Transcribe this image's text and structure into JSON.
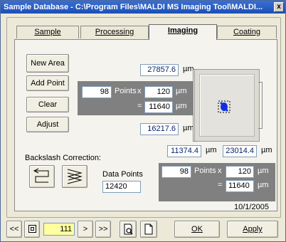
{
  "window": {
    "title": "Sample Database - C:\\Program Files\\MALDI MS Imaging Tool\\MALDI...",
    "close_glyph": "x"
  },
  "tabs": [
    {
      "label": "Sample",
      "active": false
    },
    {
      "label": "Processing",
      "active": false
    },
    {
      "label": "Imaging",
      "active": true
    },
    {
      "label": "Coating",
      "active": false
    }
  ],
  "buttons": {
    "new_area": "New Area",
    "add_point": "Add Point",
    "clear": "Clear",
    "adjust": "Adjust"
  },
  "area": {
    "top_value": "27857.6",
    "top_unit": "µm",
    "points_x": "98",
    "points_label": "Points",
    "times": "x",
    "step_x": "120",
    "step_x_unit": "µm",
    "equals": "=",
    "size_x": "11640",
    "size_x_unit": "µm",
    "bottom_value": "16217.6",
    "bottom_unit": "µm",
    "coord_x": "11374.4",
    "coord_x_unit": "µm",
    "coord_y": "23014.4",
    "coord_y_unit": "µm"
  },
  "backslash": {
    "label": "Backslash Correction:"
  },
  "data_points": {
    "label": "Data Points",
    "value": "12420"
  },
  "lower": {
    "points": "98",
    "points_label": "Points",
    "times": "x",
    "step": "120",
    "step_unit": "µm",
    "equals": "=",
    "size": "11640",
    "size_unit": "µm",
    "date": "10/1/2005"
  },
  "nav": {
    "first": "<<",
    "record": "111",
    "next": ">",
    "last": ">>",
    "ok": "OK",
    "apply": "Apply"
  },
  "colors": {
    "title_bar": "#1c4fb8",
    "record_field": "#ffffa0",
    "accent_blue": "#0a246a"
  }
}
